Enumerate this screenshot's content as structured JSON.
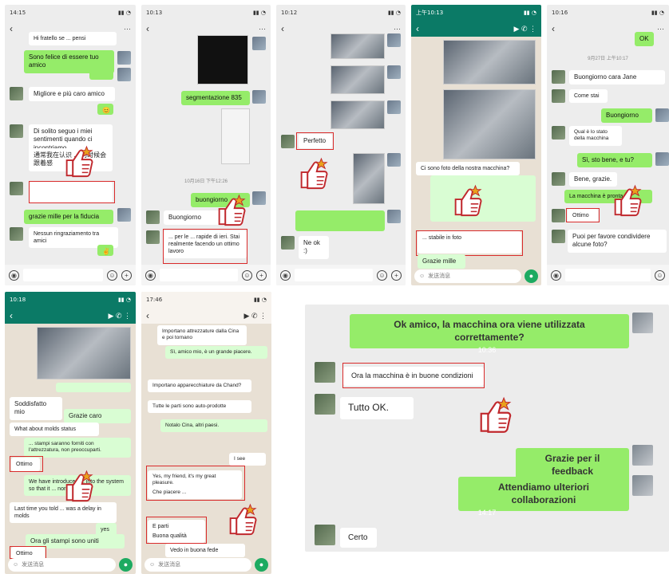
{
  "panel1": {
    "time": "14:15",
    "messages": [
      "Hi fratello se ... pensi",
      "Sono felice di essere tuo amico",
      "Migliore e più caro amico",
      "Di solito seguo i miei sentimenti quando ci incontriamo",
      "通常我在认识 ... 的时候会跟着感",
      "grazie mille per la fiducia",
      "Nessun ringraziamento tra amici"
    ]
  },
  "panel2": {
    "time": "10:13",
    "messages": [
      "segmentazione 835",
      "buongiorno",
      "Buongiorno",
      "... per le ... rapide di ieri. Stai realmente facendo un ottimo lavoro"
    ]
  },
  "panel3": {
    "time": "10:12",
    "messages": [
      "Perfetto",
      "Ne ok :)"
    ]
  },
  "panel4": {
    "time": "上午10:13",
    "messages": [
      "Ci sono foto della nostra macchina?",
      "Grazie mille",
      "... stabile in foto"
    ],
    "input_placeholder": "发送消息"
  },
  "panel5": {
    "time": "10:16",
    "ok": "OK",
    "messages": [
      "Buongiorno cara Jane",
      "Come stai",
      "Buongiorno",
      "Qual è lo stato della macchina",
      "Sì, sto bene, e tu?",
      "Bene, grazie.",
      "La macchina è pronta",
      "Ottimo",
      "Puoi per favore condividere alcune foto?"
    ]
  },
  "panel6": {
    "time": "10:18",
    "messages": [
      "Soddisfatto mio",
      "Grazie caro",
      "What about molds status",
      "... stampi saranno forniti con l'attrezzatura, non preoccuparti.",
      "Ottimo",
      "We have introduced ... into the system so that it ... normally.",
      "Last time you told ... was a delay in molds",
      "yes",
      "Ora gli stampi sono uniti",
      "Ottimo"
    ],
    "input_placeholder": "发送消息"
  },
  "panel7": {
    "time": "17:46",
    "messages": [
      "Importano attrezzature dalla Cina e poi tornano",
      "Sì, amico mio, è un grande piacere.",
      "Importano apparecchiature da Chand?",
      "Tutte le parti sono auto-prodotte",
      "Notalo Cina, altri paesi.",
      "I see",
      "Yes, my friend, it's my great pleasure.",
      "Che piacere ... ",
      "E parti",
      "Buona qualità",
      "Vedo in buona fede"
    ],
    "input_placeholder": "发送消息"
  },
  "panel8": {
    "messages": [
      "Ok amico, la macchina ora viene utilizzata correttamente?",
      "10:36",
      "Ora la macchina è in buone condizioni",
      "Tutto OK.",
      "Grazie per il feedback",
      "Attendiamo ulteriori collaborazioni",
      "14:17",
      "Certo"
    ]
  }
}
